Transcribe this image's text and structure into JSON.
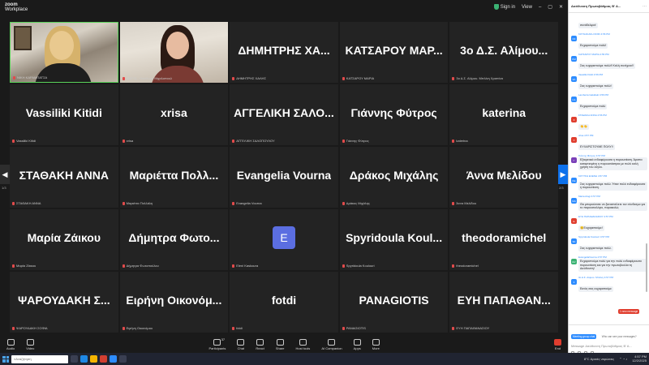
{
  "app": {
    "brand_line1": "zoom",
    "brand_line2": "Workplace",
    "security": "Sign in",
    "view": "View"
  },
  "tiles": [
    {
      "type": "video1",
      "label": "ΝΙΚΗ ΚΑΡΑΜΠΑΤΣΑ"
    },
    {
      "type": "video2",
      "label": "ΑΝΕΤΑ - Οικοδομα Μιχαλοπουλ"
    },
    {
      "name": "ΔΗΜΗΤΡΗΣ ΧΑ...",
      "label": "ΔΗΜΗΤΡΗΣ ΧΑΛΗΣ"
    },
    {
      "name": "ΚΑΤΣΑΡΟΥ ΜΑΡ...",
      "label": "ΚΑΤΣΑΡΟΥ ΜΑΡΙΑ"
    },
    {
      "name": "3ο Δ.Σ. Αλίμου...",
      "label": "3ο Δ.Σ. Αλίμου. Μπλίνη Χριστίνα"
    },
    {
      "name": "Vassiliki Kitidi",
      "label": "Vassiliki Kitidi"
    },
    {
      "name": "xrisa",
      "label": "xrisa"
    },
    {
      "name": "ΑΓΓΕΛΙΚΗ ΣΑΛΟ...",
      "label": "ΑΓΓΕΛΙΚΗ ΣΑΛΟΠΟΥΛΟΥ"
    },
    {
      "name": "Γιάννης Φύτρος",
      "label": "Γιάννης Φύτρος"
    },
    {
      "name": "katerina",
      "label": "katerina"
    },
    {
      "name": "ΣΤΑΘΑΚΗ ΑΝΝΑ",
      "label": "ΣΤΑΘΑΚΗ ΑΝΝΑ"
    },
    {
      "name": "Μαριέττα Πολλ...",
      "label": "Μαριέττα Πολλάλη"
    },
    {
      "name": "Evangelia Vourna",
      "label": "Evangelia Vourna"
    },
    {
      "name": "Δράκος Μιχάλης",
      "label": "Δράκος Μιχάλης"
    },
    {
      "name": "Άννα Μελίδου",
      "label": "Άννα Μελίδου"
    },
    {
      "name": "Μαρία Ζάικου",
      "label": "Μαρία Ζάικου"
    },
    {
      "name": "Δήμητρα Φωτο...",
      "label": "Δήμητρα Φωτοπούλου"
    },
    {
      "type": "avatar",
      "initial": "E",
      "label": "Eleni Kaskoura"
    },
    {
      "name": "Spyridoula Koul...",
      "label": "Spyridoula Koulouri"
    },
    {
      "name": "theodoramichel",
      "label": "theodoramichel"
    },
    {
      "name": "ΨΑΡΟΥΔΑΚΗ Σ...",
      "label": "ΨΑΡΟΥΔΑΚΗ ΣΟΦΙΑ"
    },
    {
      "name": "Ειρήνη Οικονόμ...",
      "label": "Ειρήνη Οικονόμου"
    },
    {
      "name": "fotdi",
      "label": "fotdi"
    },
    {
      "name": "PANAGIOTIS",
      "label": "PANAGIOTIS"
    },
    {
      "name": "ΕΥΗ ΠΑΠΑΘΑΝ...",
      "label": "ΕΥΗ ΠΑΠΑΘΑΝΑΣΙΟΥ"
    }
  ],
  "pager": {
    "left": "1/3",
    "right": "2/3"
  },
  "toolbar": {
    "left": [
      {
        "label": "Audio"
      },
      {
        "label": "Video"
      }
    ],
    "center": [
      {
        "label": "Participants",
        "count": "37"
      },
      {
        "label": "Chat"
      },
      {
        "label": "React"
      },
      {
        "label": "Share"
      },
      {
        "label": "Host tools"
      },
      {
        "label": "AI Companion"
      },
      {
        "label": "Apps"
      },
      {
        "label": "More"
      }
    ],
    "leave": "End"
  },
  "chat": {
    "title": "Διεύθυνση Πρωτοβάθμιας Β' Α...",
    "messages": [
      {
        "who": "",
        "text": "συνάδελφοι!",
        "color": "#7a7a7a",
        "ini": ""
      },
      {
        "who": "ΚΟΥΝΑΚΑΚΗ ΣΟΦΙ 4:56 PM",
        "text": "Ευχαριστούμε πολύ!",
        "color": "#2d8cff",
        "ini": "KΣ"
      },
      {
        "who": "ΚΑΤΣΑΡΟΥ ΜΑΡΙΑ 4:56 PM",
        "text": "Σας ευχαριστούμε πολύ!! Καλή συνέχεια!!",
        "color": "#2d8cff",
        "ini": "KM"
      },
      {
        "who": "Vassiliki Kitidi 4:56 PM",
        "text": "Σας ευχαριστούμε πολύ!",
        "color": "#2d8cff",
        "ini": "VK"
      },
      {
        "who": "Lamberia Gakidaki 4:56 PM",
        "text": "Ευχαριστούμε πολύ",
        "color": "#2d8cff",
        "ini": "LG"
      },
      {
        "who": "ΣΤΑΘΑΚΗ ΑΝΝΑ 4:56 PM",
        "text": "👏👏",
        "color": "#e03e2f",
        "ini": "Σ"
      },
      {
        "who": "xrisa 4:57 PM",
        "text": "ΕΥΧΑΡΙΣΤΟΥΜΕ ΠΟΛΥ!!",
        "color": "#e03e2f",
        "ini": "X"
      },
      {
        "who": "Γιάννης Φύτρος 4:57 PM",
        "text": "Εξαιρετικά ενδιαφέρουσα η παρουσίαση. Άριστα καταρτισμένη η παρουσιάστρια με πολύ καλή χρήση του λόγου.",
        "color": "#7a3fb8",
        "ini": "Γ"
      },
      {
        "who": "ΚΟΥΤΣΗ ΕΛΕΝΗ 4:57 PM",
        "text": "Σας ευχαριστούμε πολύ. Ήταν πολύ ενδιαφέρουσα η παρουσίαση.",
        "color": "#2d8cff",
        "ini": "ΚΕ"
      },
      {
        "who": "Maria Alogi 4:57 PM",
        "text": "Θα μπορούσατε να ξαναστείλετε τον σύνδεσμο για το παρουσιολόγιο, παρακαλώ;",
        "color": "#2d8cff",
        "ini": "MA"
      },
      {
        "who": "ΕΥΗ ΠΑΠΑΘΑΝΑΣΙΟΥ 4:57 PM",
        "text": "😊Ευχαριστούμε!",
        "color": "#e03e2f",
        "ini": "E"
      },
      {
        "who": "Spyridoula Koulouri 4:57 PM",
        "text": "Σας ευχαριστούμε πολύ.",
        "color": "#2d8cff",
        "ini": "SK"
      },
      {
        "who": "EvangeliaVourna 4:57 PM",
        "text": "Ευχαριστούμε πολύ για την πολύ ενδιαφέρουσα παρουσίαση και για την πρωτοβουλία τη Διεύθυνση!",
        "color": "#3bb273",
        "ini": "EV"
      },
      {
        "who": "3ο Δ.Σ. Αλίμου. Μπλίνη 4:57 PM",
        "text": "Εκτός σας ευχαριστούμε",
        "color": "#2d8cff",
        "ini": "3"
      }
    ],
    "new_message": "1 new message",
    "to_label": "Meeting group chat",
    "who_can_see": "Who can see your messages?",
    "input_placeholder": "Message Διεύθυνση Πρωτοβάθμιας Β' Α..."
  },
  "taskbar": {
    "search": "Αναζήτηση",
    "weather": "8°C Αραιές νεφώσεις",
    "time": "4:57 PM",
    "date": "12/2/2025"
  }
}
